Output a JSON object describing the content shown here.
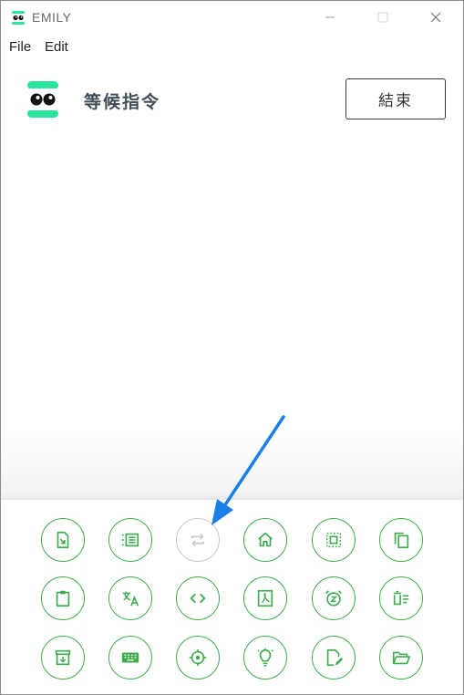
{
  "window": {
    "title": "EMILY",
    "controls": [
      "minimize-icon",
      "maximize-icon",
      "close-icon"
    ]
  },
  "menu": {
    "file": "File",
    "edit": "Edit"
  },
  "header": {
    "status": "等候指令",
    "end_button": "結束"
  },
  "colors": {
    "accent": "#3fac4f",
    "logo_green": "#2be69a",
    "arrow_blue": "#1a7fe8",
    "disabled": "#c8c8c8"
  },
  "toolbar": {
    "rows": [
      [
        "file-export-icon",
        "list-icon",
        "repeat-icon",
        "home-icon",
        "select-all-icon",
        "copy-icon"
      ],
      [
        "clipboard-icon",
        "translate-icon",
        "code-icon",
        "pdf-icon",
        "snooze-alarm-icon",
        "delete-list-icon"
      ],
      [
        "archive-icon",
        "keyboard-icon",
        "crosshair-icon",
        "lightbulb-icon",
        "edit-file-icon",
        "folder-open-icon"
      ]
    ],
    "disabled": [
      "repeat-icon"
    ]
  }
}
